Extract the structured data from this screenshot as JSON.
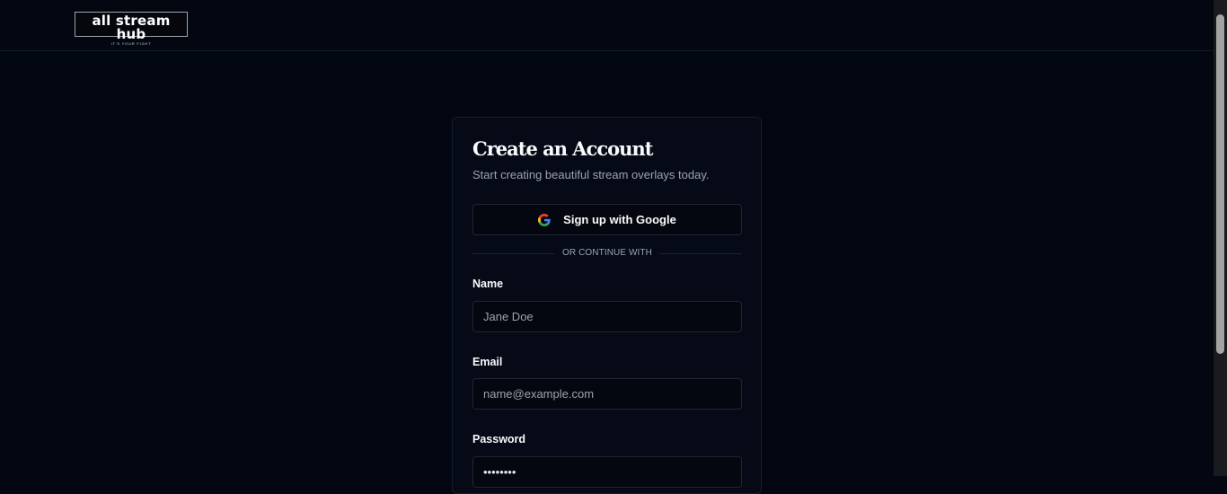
{
  "header": {
    "logo_text": "all stream hub",
    "logo_tagline": "IT'S YOUR FIGHT"
  },
  "card": {
    "title": "Create an Account",
    "subtitle": "Start creating beautiful stream overlays today.",
    "google_button_label": "Sign up with Google",
    "google_icon": "google-g-icon",
    "divider_text": "OR CONTINUE WITH",
    "name": {
      "label": "Name",
      "placeholder": "Jane Doe",
      "value": ""
    },
    "email": {
      "label": "Email",
      "placeholder": "name@example.com",
      "value": ""
    },
    "password": {
      "label": "Password",
      "value": "••••••••"
    }
  },
  "colors": {
    "background": "#030712",
    "card": "#060a17",
    "border": "#1f2633",
    "muted_text": "#9ca3af"
  }
}
